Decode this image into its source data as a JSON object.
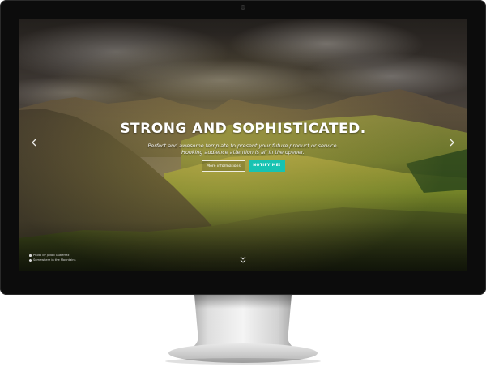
{
  "hero": {
    "title": "STRONG AND SOPHISTICATED.",
    "subtitle_line1": "Perfect and awesome template to present your future product or service.",
    "subtitle_line2": "Hooking audience attention is all in the opener."
  },
  "buttons": {
    "more_label": "More informations",
    "notify_label": "NOTIFY ME!"
  },
  "navigation": {
    "prev_icon": "chevron-left-icon",
    "next_icon": "chevron-right-icon",
    "scroll_icon": "double-chevron-down-icon"
  },
  "credits": {
    "photo": "Photo by Jakob Gutierrez",
    "location": "Somewhere in the Mountains"
  },
  "colors": {
    "accent": "#17c3b2",
    "bezel": "#0c0c0c",
    "text": "#ffffff"
  }
}
